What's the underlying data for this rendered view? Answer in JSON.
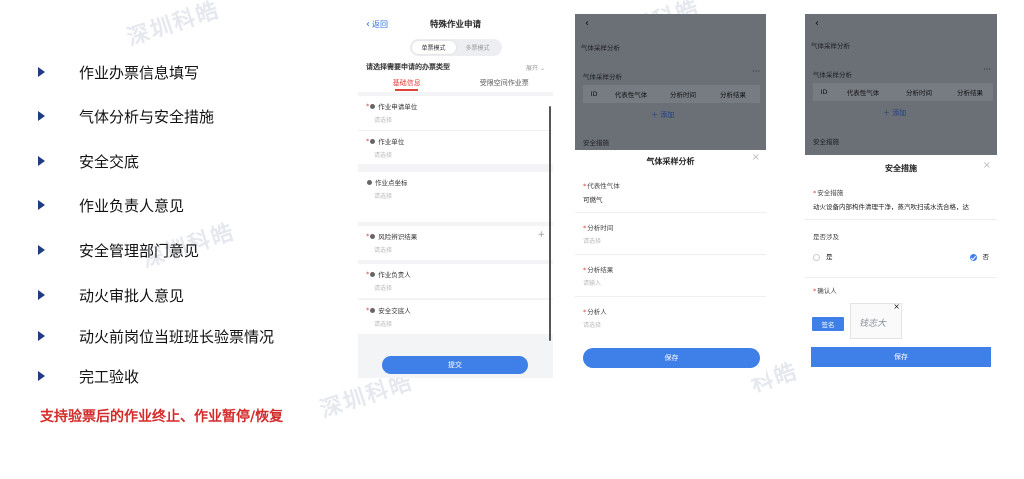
{
  "watermarks": [
    "深圳科皓",
    "深圳科皓",
    "深圳科皓",
    "深圳科皓",
    "科皓"
  ],
  "features": [
    "作业办票信息填写",
    "气体分析与安全措施",
    "安全交底",
    "作业负责人意见",
    "安全管理部门意见",
    "动火审批人意见",
    "动火前岗位当班班长验票情况",
    "完工验收"
  ],
  "highlight": "支持验票后的作业终止、作业暂停/恢复",
  "phone1": {
    "back_label": "返回",
    "title": "特殊作业申请",
    "mode_single": "单票模式",
    "mode_multi": "多票模式",
    "ticket_type_prompt": "请选择需要申请的办票类型",
    "expand_label": "展开",
    "tab_basic": "基础信息",
    "tab_space": "受限空间作业票",
    "fields": [
      {
        "label": "作业申请单位",
        "placeholder": "请选择",
        "required": "*"
      },
      {
        "label": "作业单位",
        "placeholder": "请选择",
        "required": "*"
      },
      {
        "label": "作业点坐标",
        "placeholder": "请选择",
        "required": ""
      },
      {
        "label": "风险辨识结果",
        "placeholder": "请选择",
        "required": "*"
      },
      {
        "label": "作业负责人",
        "placeholder": "请选择",
        "required": "*"
      },
      {
        "label": "安全交底人",
        "placeholder": "请选择",
        "required": "*"
      }
    ],
    "submit_label": "提交"
  },
  "phone2": {
    "bg_section": "气体采样分析",
    "bg_section2": "气体采样分析",
    "table_headers": [
      "ID",
      "代表性气体",
      "分析时间",
      "分析结果"
    ],
    "add_label": "添加",
    "bg_section3": "安全措施",
    "sheet_title": "气体采样分析",
    "fields": [
      {
        "label": "代表性气体",
        "value": "可燃气",
        "placeholder": ""
      },
      {
        "label": "分析时间",
        "value": "",
        "placeholder": "请选择"
      },
      {
        "label": "分析结果",
        "value": "",
        "placeholder": "请输入"
      },
      {
        "label": "分析人",
        "value": "",
        "placeholder": "请选择"
      }
    ],
    "save_label": "保存"
  },
  "phone3": {
    "bg_section": "气体采样分析",
    "bg_section2": "气体采样分析",
    "table_headers": [
      "ID",
      "代表性气体",
      "分析时间",
      "分析结果"
    ],
    "add_label": "添加",
    "bg_section3": "安全措施",
    "sheet_title": "安全措施",
    "measure_label": "安全措施",
    "measure_value": "动火设备内部构件清理干净，蒸汽吹扫或水洗合格，达",
    "involved_label": "是否涉及",
    "yes_label": "是",
    "no_label": "否",
    "confirmer_label": "确认人",
    "sign_label": "签名",
    "signature_text": "钱志大",
    "save_label": "保存"
  }
}
